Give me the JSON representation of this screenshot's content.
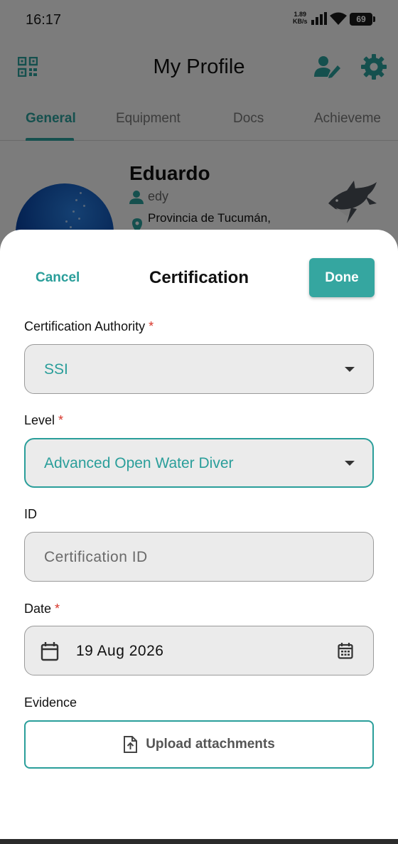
{
  "status_bar": {
    "time": "16:17",
    "rate_value": "1.89",
    "rate_unit": "KB/s",
    "battery": "69"
  },
  "header": {
    "title": "My Profile"
  },
  "tabs": [
    {
      "label": "General",
      "active": true
    },
    {
      "label": "Equipment",
      "active": false
    },
    {
      "label": "Docs",
      "active": false
    },
    {
      "label": "Achieveme",
      "active": false
    }
  ],
  "profile": {
    "name": "Eduardo",
    "username": "edy",
    "location": "Provincia de Tucumán,"
  },
  "sheet": {
    "cancel_label": "Cancel",
    "title": "Certification",
    "done_label": "Done",
    "required_marker": "*",
    "authority": {
      "label": "Certification Authority",
      "value": "SSI"
    },
    "level": {
      "label": "Level",
      "value": "Advanced Open Water Diver"
    },
    "id": {
      "label": "ID",
      "placeholder": "Certification ID"
    },
    "date": {
      "label": "Date",
      "value": "19 Aug 2026"
    },
    "evidence": {
      "label": "Evidence",
      "upload_label": "Upload attachments"
    }
  },
  "colors": {
    "accent": "#2a9e9a",
    "required": "#d8352a"
  }
}
